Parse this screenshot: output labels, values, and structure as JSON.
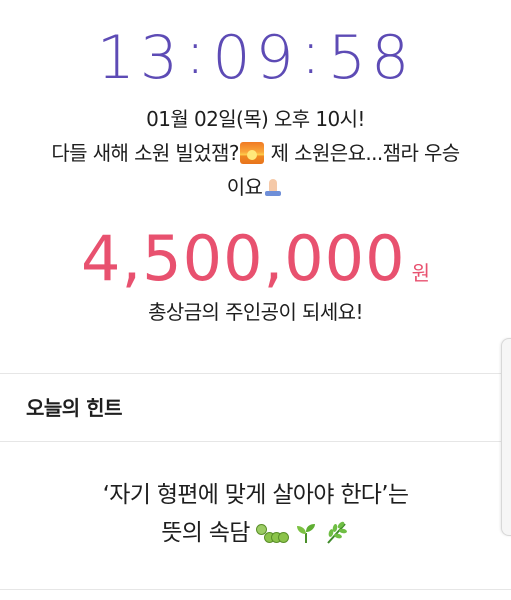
{
  "countdown": {
    "hours": "13",
    "minutes": "09",
    "seconds": "58",
    "separator": ":"
  },
  "announcement": {
    "line1": "01월 02일(목) 오후 10시!",
    "line2": "다들 새해 소원 빌었잼?",
    "line2_after": "제 소원은요...잼라 우승",
    "line3": "이요"
  },
  "prize": {
    "amount": "4,500,000",
    "unit": "원",
    "subtitle": "총상금의 주인공이 되세요!"
  },
  "hint": {
    "title": "오늘의 힌트",
    "body_line1": "‘자기 형편에 맞게 살아야 한다’는",
    "body_line2": "뜻의 속담"
  },
  "colors": {
    "countdown": "#5d4bb5",
    "prize": "#e8516f",
    "text": "#1e1e1e",
    "divider": "#e6e6e6"
  },
  "icons": [
    "sunrise-emoji",
    "folded-hands-emoji",
    "caterpillar-emoji",
    "seedling-emoji",
    "herb-emoji"
  ]
}
